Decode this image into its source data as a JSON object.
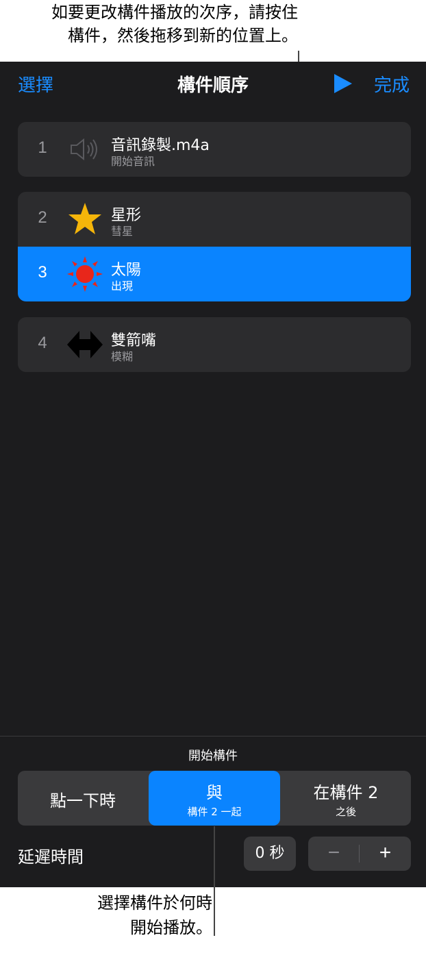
{
  "callouts": {
    "top_line1": "如要更改構件播放的次序，請按住",
    "top_line2": "構件，然後拖移到新的位置上。",
    "bottom_line1": "選擇構件於何時",
    "bottom_line2": "開始播放。"
  },
  "nav": {
    "select_label": "選擇",
    "title": "構件順序",
    "play_icon": "play-icon",
    "done_label": "完成",
    "accent_color": "#1a8cff"
  },
  "builds": [
    {
      "number": "1",
      "name": "音訊錄製.m4a",
      "effect": "開始音訊",
      "icon": "speaker-icon"
    },
    {
      "number": "2",
      "name": "星形",
      "effect": "彗星",
      "icon": "star-icon"
    },
    {
      "number": "3",
      "name": "太陽",
      "effect": "出現",
      "icon": "sun-icon",
      "selected": true
    },
    {
      "number": "4",
      "name": "雙箭嘴",
      "effect": "模糊",
      "icon": "double-arrow-icon"
    }
  ],
  "start": {
    "label": "開始構件",
    "options": [
      {
        "main": "點一下時",
        "sub": ""
      },
      {
        "main": "與",
        "sub": "構件 2 一起",
        "selected": true
      },
      {
        "main": "在構件 2",
        "sub": "之後"
      }
    ]
  },
  "delay": {
    "label": "延遲時間",
    "value": "0 秒",
    "minus": "−",
    "plus": "+"
  },
  "colors": {
    "selected_blue": "#0a84ff",
    "panel_bg": "#1c1c1e",
    "row_bg": "#2c2c2e",
    "star": "#f5b50a",
    "sun": "#e8261b"
  }
}
